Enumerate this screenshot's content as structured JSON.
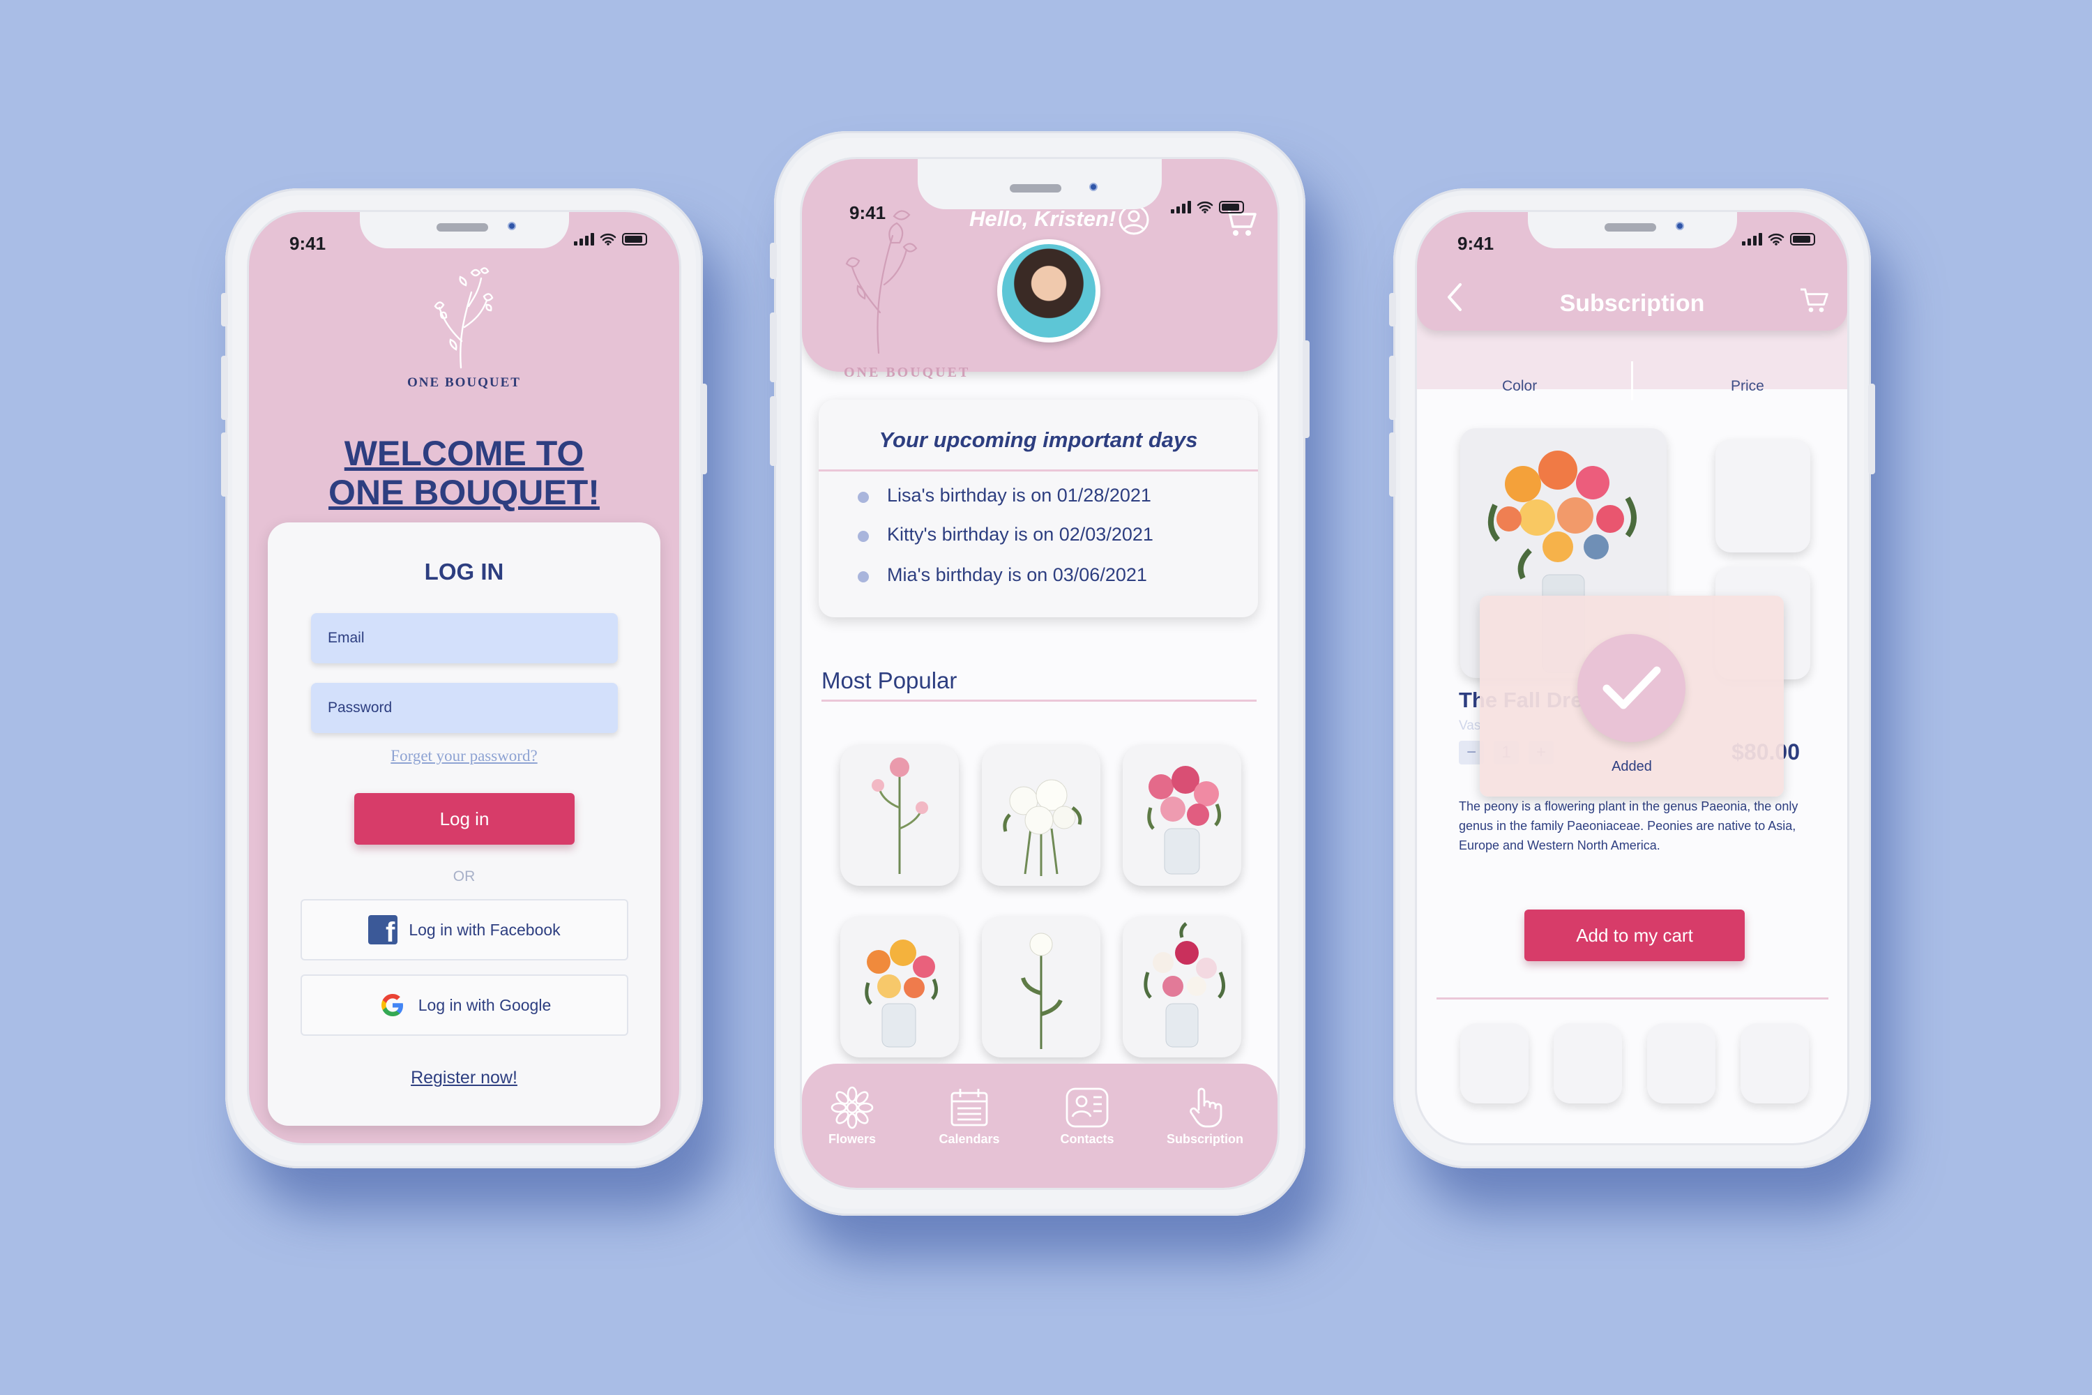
{
  "status_time": "9:41",
  "colors": {
    "background": "#a9bde6",
    "pink": "#e6c2d5",
    "navy": "#2d3e80",
    "accent": "#d73c69",
    "input": "#d3e0fb"
  },
  "login_screen": {
    "logo_text": "ONE BOUQUET",
    "welcome_line1": "WELCOME TO",
    "welcome_line2": "ONE BOUQUET!",
    "title": "LOG IN",
    "email_placeholder": "Email",
    "password_placeholder": "Password",
    "forgot_link": "Forget your password?",
    "login_button": "Log in",
    "or_text": "OR",
    "facebook_button": "Log in with Facebook",
    "facebook_icon": "facebook-icon",
    "google_button": "Log in with Google",
    "google_icon": "google-icon",
    "register_link": "Register now!"
  },
  "home_screen": {
    "greeting": "Hello, Kristen!",
    "user_icon": "user-circle-icon",
    "cart_icon": "cart-icon",
    "logo_text": "ONE BOUQUET",
    "important_days_title": "Your upcoming important days",
    "important_days": [
      "Lisa's birthday is on 01/28/2021",
      "Kitty's birthday is on 02/03/2021",
      "Mia's birthday is on 03/06/2021"
    ],
    "most_popular_title": "Most Popular",
    "tabs": [
      {
        "label": "Flowers",
        "icon": "flower-icon"
      },
      {
        "label": "Calendars",
        "icon": "calendar-icon"
      },
      {
        "label": "Contacts",
        "icon": "contacts-icon"
      },
      {
        "label": "Subscription",
        "icon": "hand-pointer-icon"
      }
    ]
  },
  "subscription_screen": {
    "title": "Subscription",
    "back_icon": "back-arrow-icon",
    "cart_icon": "cart-icon",
    "filters": [
      "Color",
      "Price"
    ],
    "added_label": "Added",
    "product_name": "The Fall Dre",
    "product_subtitle": "Vas",
    "quantity": "1",
    "qty_minus": "−",
    "qty_plus": "+",
    "price": "$80.00",
    "description": "The peony is a flowering plant in the genus Paeonia, the only genus in the family Paeoniaceae. Peonies are native to Asia, Europe and Western North America.",
    "add_to_cart_button": "Add to my cart"
  }
}
